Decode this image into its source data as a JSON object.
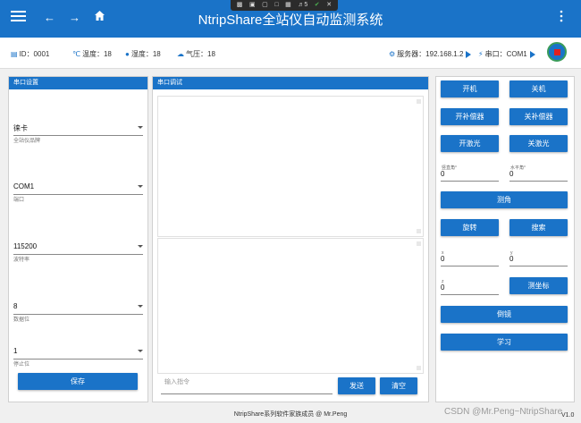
{
  "window": {
    "title": "NtripShare全站仪自动监测系统"
  },
  "taskbar": {
    "badge": "5"
  },
  "status": {
    "id": "ID：0001",
    "temperature": "温度：18",
    "humidity": "湿度：18",
    "pressure": "气压：18",
    "server": "服务器：192.168.1.2",
    "port": "串口：COM1"
  },
  "serial_settings": {
    "title": "串口设置",
    "brand_value": "徕卡",
    "brand_label": "全站仪品牌",
    "port_value": "COM1",
    "port_label": "端口",
    "baud_value": "115200",
    "baud_label": "波特率",
    "data_value": "8",
    "data_label": "数据位",
    "stop_value": "1",
    "stop_label": "停止位",
    "save_label": "保存"
  },
  "serial_debug": {
    "title": "串口调试",
    "input_placeholder": "输入指令",
    "send_label": "发送",
    "clear_label": "清空"
  },
  "control": {
    "power_on": "开机",
    "power_off": "关机",
    "comp_on": "开补偿器",
    "comp_off": "关补偿器",
    "laser_on": "开激光",
    "laser_off": "关激光",
    "vertical_label": "竖直角°",
    "vertical_value": "0",
    "horizontal_label": "水平角°",
    "horizontal_value": "0",
    "measure_angle": "测角",
    "rotate": "旋转",
    "search": "搜索",
    "x_label": "x",
    "x_value": "0",
    "y_label": "y",
    "y_value": "0",
    "z_label": "z",
    "z_value": "0",
    "measure_coord": "测坐标",
    "invert": "倒镜",
    "learn": "学习"
  },
  "footer": {
    "text": "NtripShare系列软件家族成员 @ Mr.Peng",
    "version": "V1.0",
    "watermark": "CSDN @Mr.Peng~NtripShare"
  }
}
